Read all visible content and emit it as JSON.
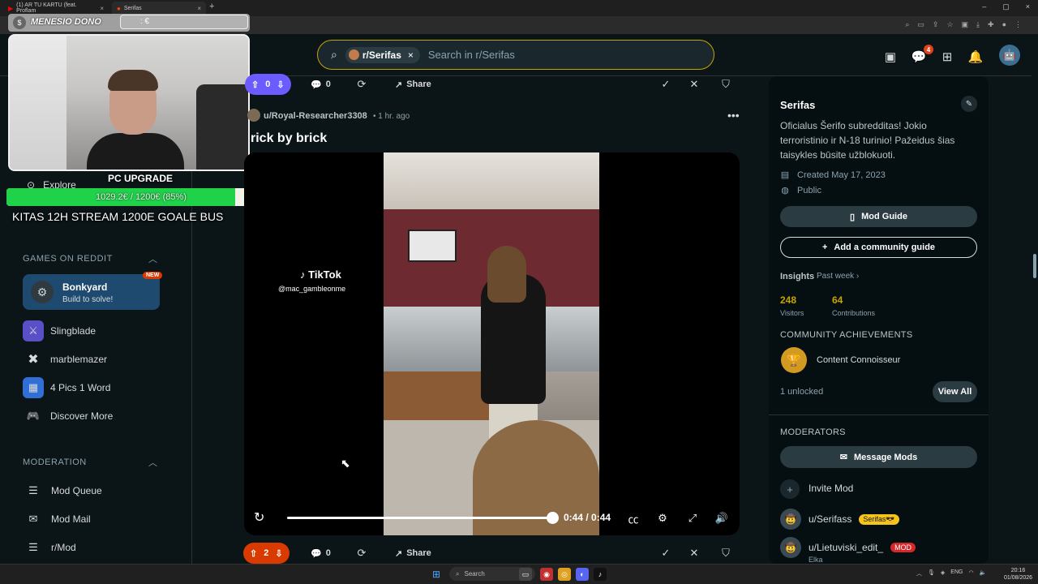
{
  "browser": {
    "tabs": [
      {
        "label": "(1) AR TU KARTU (feat. Proflam",
        "close": "×"
      },
      {
        "label": "Serifas",
        "close": "×"
      }
    ],
    "new_tab": "+",
    "window_controls": [
      "–",
      "▢",
      "×"
    ]
  },
  "header": {
    "search": {
      "chip_label": "r/Serifas",
      "chip_clear": "×",
      "placeholder": "Search in r/Serifas"
    },
    "notification_count": "4"
  },
  "overlay": {
    "donation_label": "MENESIO DONO",
    "donation_value": ": €",
    "goal_title": "PC UPGRADE",
    "goal_text": "1029.2€ / 1200€ (85%)",
    "goal_progress": 0.85,
    "goal_caption": "KITAS 12H STREAM 1200E GOALE BUS"
  },
  "left_sidebar": {
    "explore_label": "Explore",
    "games_section": "GAMES ON REDDIT",
    "featured_game": {
      "name": "Bonkyard",
      "subtitle": "Build to solve!",
      "badge": "NEW"
    },
    "games": [
      {
        "name": "Slingblade",
        "icon": "slingblade-icon",
        "color": "#5b4fc7"
      },
      {
        "name": "marblemazer",
        "icon": "marble-icon",
        "color": "#0b1416"
      },
      {
        "name": "4 Pics 1 Word",
        "icon": "pics-icon",
        "color": "#2f6fd6"
      },
      {
        "name": "Discover More",
        "icon": "controller-icon",
        "color": "#0b1416"
      }
    ],
    "moderation_section": "MODERATION",
    "mod_items": [
      {
        "label": "Mod Queue",
        "icon": "queue-icon"
      },
      {
        "label": "Mod Mail",
        "icon": "mail-icon"
      },
      {
        "label": "r/Mod",
        "icon": "list-icon"
      }
    ]
  },
  "feed": {
    "top_bar": {
      "votes": "0",
      "comments": "0",
      "share": "Share"
    },
    "post": {
      "author": "u/Royal-Researcher3308",
      "time": "• 1 hr. ago",
      "title": "rick by brick",
      "watermark": "TikTok",
      "watermark_user": "@mac_gambleonme",
      "time_display": "0:44 / 0:44",
      "progress": 1.0
    },
    "bottom_bar": {
      "votes": "2",
      "comments": "0",
      "share": "Share"
    }
  },
  "right_sidebar": {
    "name": "Serifas",
    "description": "Oficialus Šerifo subredditas! Jokio terroristinio ir N-18 turinio! Pažeidus šias taisykles būsite užblokuoti.",
    "created": "Created May 17, 2023",
    "visibility": "Public",
    "mod_guide": "Mod Guide",
    "add_guide": "Add a community guide",
    "insights_label": "Insights",
    "insights_range": "Past week ›",
    "visitors": "248",
    "visitors_label": "Visitors",
    "contributions": "64",
    "contributions_label": "Contributions",
    "achievements_section": "COMMUNITY ACHIEVEMENTS",
    "achievement": "Content Connoisseur",
    "unlocked": "1 unlocked",
    "view_all": "View All",
    "moderators_section": "MODERATORS",
    "message_mods": "Message Mods",
    "invite_mod": "Invite Mod",
    "mods": [
      {
        "name": "u/Serifass",
        "flair": "Serifas😎"
      },
      {
        "name": "u/Lietuviski_edit_",
        "flair": "MOD",
        "sub": "Elka"
      }
    ]
  },
  "taskbar": {
    "search_placeholder": "Search",
    "clock_time": "20:16",
    "clock_date": "01/08/2026",
    "lang": "ENG"
  },
  "colors": {
    "background": "#0b1416",
    "upvote_active": "#d93a00",
    "upvote_blue": "#6a5cff",
    "accent_yellow": "#c8a400",
    "goal_green": "#1fd24a"
  }
}
